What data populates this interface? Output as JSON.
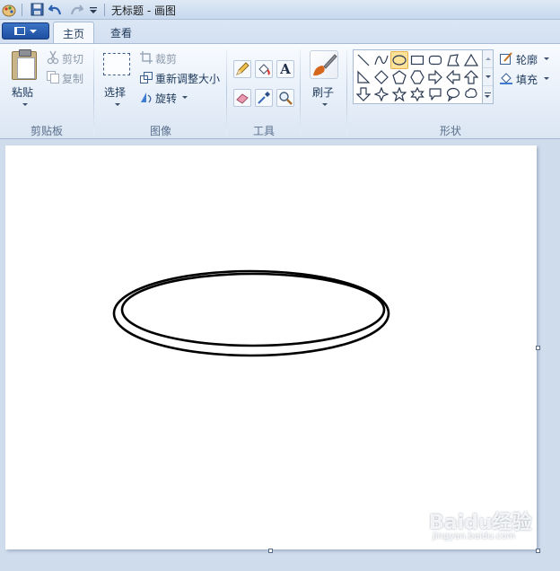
{
  "window": {
    "title": "无标题 - 画图"
  },
  "tabs": [
    {
      "label": "主页"
    },
    {
      "label": "查看"
    }
  ],
  "clipboard": {
    "paste_label": "粘贴",
    "cut_label": "剪切",
    "copy_label": "复制",
    "group_label": "剪贴板"
  },
  "image": {
    "select_label": "选择",
    "crop_label": "裁剪",
    "resize_label": "重新调整大小",
    "rotate_label": "旋转",
    "group_label": "图像"
  },
  "tools": {
    "text_tool_glyph": "A",
    "group_label": "工具"
  },
  "brush": {
    "label": "刷子"
  },
  "shapes": {
    "outline_label": "轮廓",
    "fill_label": "填充",
    "group_label": "形状",
    "selected": "oval"
  },
  "watermark": {
    "text": "Baidu经验",
    "subtext": "jingyan.baidu.com"
  },
  "colors": {
    "accent": "#1f4fa0",
    "canvas": "#ffffff",
    "workspace": "#cfdcec",
    "selection": "#fde39a"
  }
}
